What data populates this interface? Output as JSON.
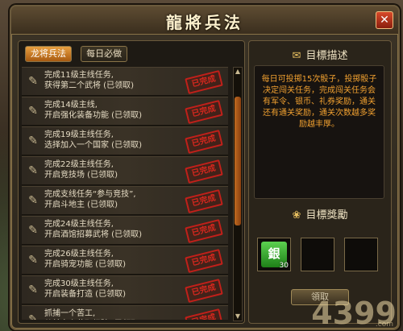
{
  "window": {
    "title": "龍將兵法"
  },
  "tabs": [
    {
      "label": "龙将兵法"
    },
    {
      "label": "每日必做"
    }
  ],
  "tasks": [
    {
      "text": "完成11级主线任务,\n获得第二个武将 (已领取)",
      "stamp": "已完成"
    },
    {
      "text": "完成14级主线,\n开启强化装备功能 (已领取)",
      "stamp": "已完成"
    },
    {
      "text": "完成19级主线任务,\n选择加入一个国家 (已领取)",
      "stamp": "已完成"
    },
    {
      "text": "完成22级主线任务,\n开启竞技场 (已领取)",
      "stamp": "已完成"
    },
    {
      "text": "完成支线任务“参与竞技”,\n开启斗地主 (已领取)",
      "stamp": "已完成"
    },
    {
      "text": "完成24级主线任务,\n开启酒馆招募武将 (已领取)",
      "stamp": "已完成"
    },
    {
      "text": "完成26级主线任务,\n开启骑宠功能 (已领取)",
      "stamp": "已完成"
    },
    {
      "text": "完成30级主线任务,\n开启装备打造 (已领取)",
      "stamp": "已完成"
    },
    {
      "text": "抓捕一个苦工,\n从其身上获取经验 (已领取)",
      "stamp": "已完成"
    }
  ],
  "goal": {
    "heading": "目標描述",
    "description": "每日可投掷15次骰子，投掷骰子决定闯关任务，完成闯关任务会有军令、银币、礼券奖励，通关还有通关奖励，通关次数越多奖励越丰厚。"
  },
  "reward": {
    "heading": "目標獎勵",
    "item_glyph": "銀",
    "item_count": "30",
    "claim_label": "領取"
  },
  "watermark": {
    "main": "4399",
    "sub": ".com"
  }
}
